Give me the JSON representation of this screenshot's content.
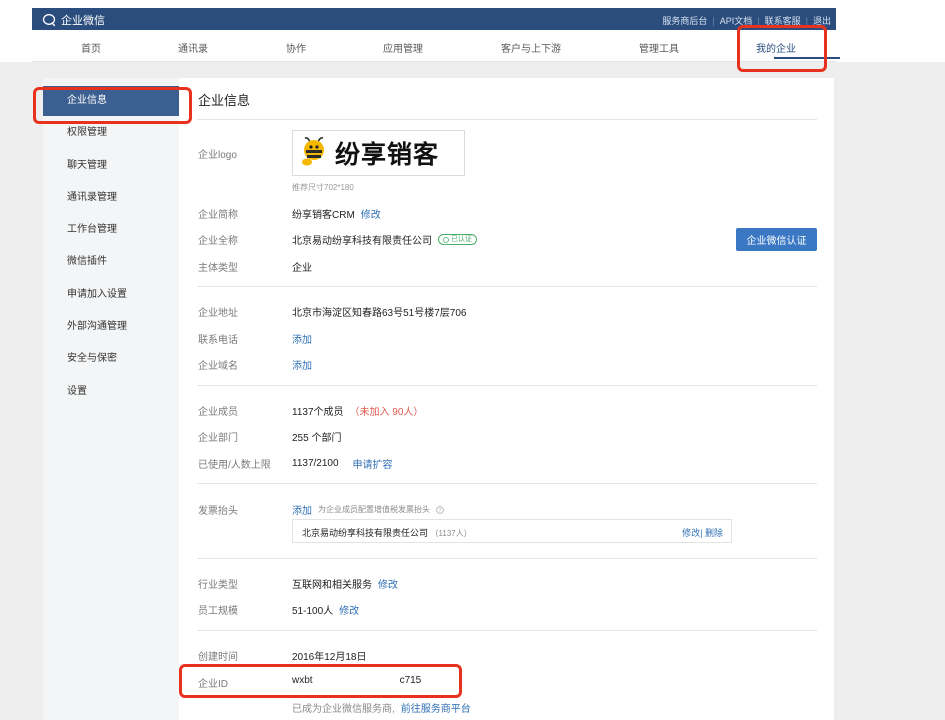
{
  "app": {
    "name": "企业微信"
  },
  "toplinks": [
    "服务商后台",
    "API文档",
    "联系客服",
    "退出"
  ],
  "nav": {
    "items": [
      "首页",
      "通讯录",
      "协作",
      "应用管理",
      "客户与上下游",
      "管理工具",
      "我的企业"
    ],
    "active": "我的企业"
  },
  "sidebar": {
    "items": [
      "企业信息",
      "权限管理",
      "聊天管理",
      "通讯录管理",
      "工作台管理",
      "微信插件",
      "申请加入设置",
      "外部沟通管理",
      "安全与保密",
      "设置"
    ],
    "active": "企业信息"
  },
  "page": {
    "title": "企业信息",
    "logo": {
      "label": "企业logo",
      "text": "纷享销客",
      "hint": "推荐尺寸702*180"
    },
    "short_name": {
      "label": "企业简称",
      "value": "纷享销客CRM",
      "action": "修改"
    },
    "full_name": {
      "label": "企业全称",
      "value": "北京易动纷享科技有限责任公司",
      "badge": "已认证"
    },
    "cert_button": "企业微信认证",
    "entity_type": {
      "label": "主体类型",
      "value": "企业"
    },
    "address": {
      "label": "企业地址",
      "value": "北京市海淀区知春路63号51号楼7层706"
    },
    "phone": {
      "label": "联系电话",
      "action": "添加"
    },
    "domain": {
      "label": "企业域名",
      "action": "添加"
    },
    "members": {
      "label": "企业成员",
      "value": "1137个成员",
      "pending": "（未加入 90人）"
    },
    "departments": {
      "label": "企业部门",
      "value": "255 个部门"
    },
    "quota": {
      "label": "已使用/人数上限",
      "value": "1137/2100",
      "action": "申请扩容"
    },
    "invoice": {
      "label": "发票抬头",
      "action": "添加",
      "hint": "为企业成员配置增值税发票抬头",
      "entry_name": "北京易动纷享科技有限责任公司",
      "entry_count": "（1137人）",
      "edit": "修改",
      "delete": "删除"
    },
    "industry": {
      "label": "行业类型",
      "value": "互联网和相关服务",
      "action": "修改"
    },
    "staff_size": {
      "label": "员工规模",
      "value": "51-100人",
      "action": "修改"
    },
    "created": {
      "label": "创建时间",
      "value": "2016年12月18日"
    },
    "corp_id": {
      "label": "企业ID",
      "value_start": "wxbt",
      "value_end": "c715"
    },
    "footer_note": "已成为企业微信服务商,",
    "footer_link": "前往服务商平台"
  },
  "colors": {
    "brand": "#2b4d7e",
    "link": "#2f6fb4",
    "highlight": "#e8321f",
    "verified": "#4cae6a"
  }
}
